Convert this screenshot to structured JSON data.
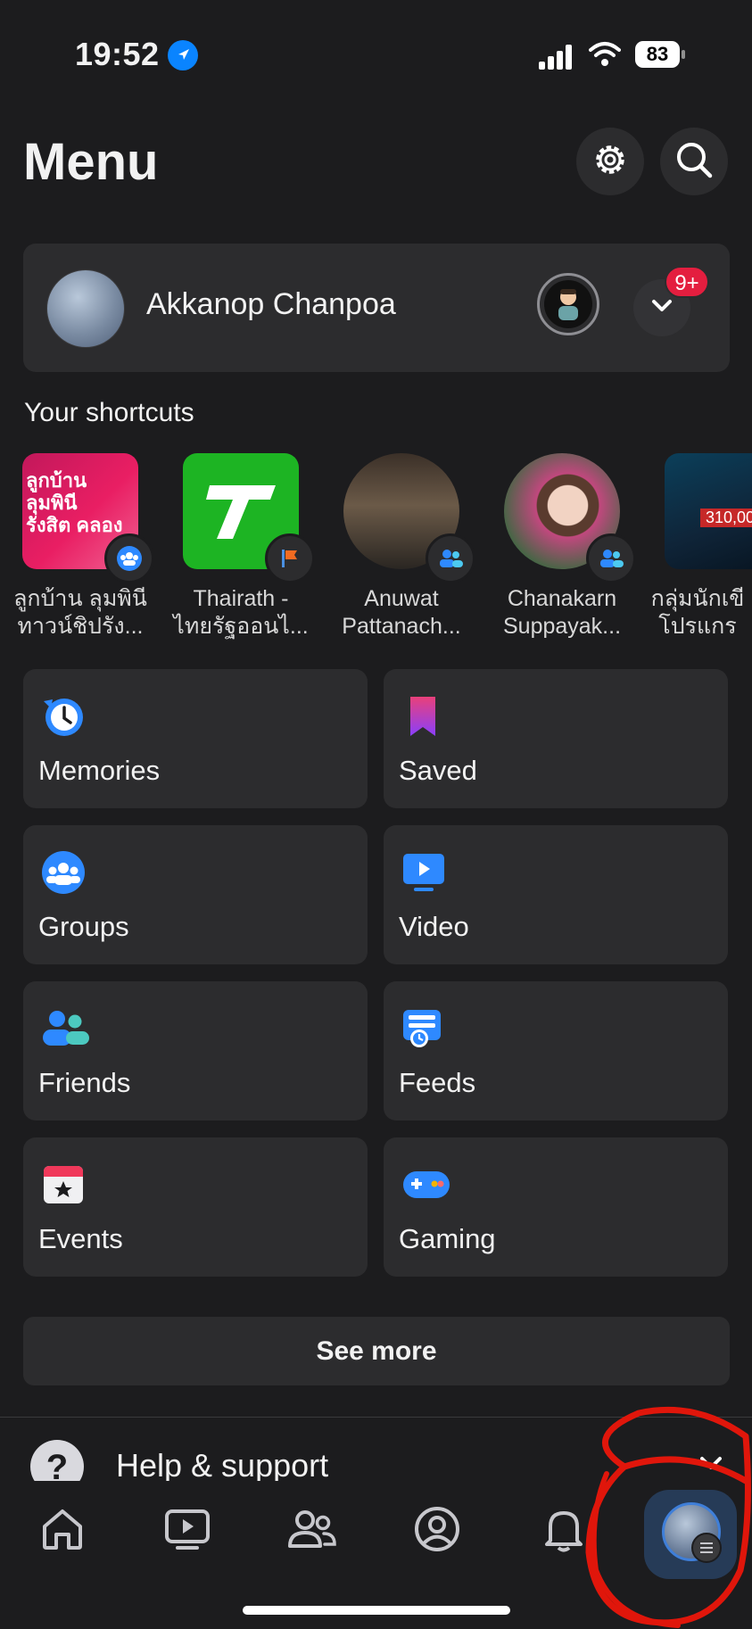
{
  "status_bar": {
    "time": "19:52",
    "battery": "83"
  },
  "header": {
    "title": "Menu"
  },
  "profile": {
    "name": "Akkanop Chanpoa",
    "notification_badge": "9+"
  },
  "shortcuts": {
    "title": "Your shortcuts",
    "items": [
      {
        "label": "ลูกบ้าน ลุมพินี\nทาวน์ชิปรัง...",
        "thumb_text": "ลูกบ้าน\nลุมพินี\nรังสิต คลอง"
      },
      {
        "label": "Thairath -\nไทยรัฐออนไ..."
      },
      {
        "label": "Anuwat\nPattanach..."
      },
      {
        "label": "Chanakarn\nSuppayak..."
      },
      {
        "label": "กลุ่มนักเขี\nโปรแกร",
        "thumb_text": "310,00"
      }
    ]
  },
  "menu": {
    "items": [
      {
        "label": "Memories",
        "icon": "memories-icon"
      },
      {
        "label": "Saved",
        "icon": "saved-icon"
      },
      {
        "label": "Groups",
        "icon": "groups-icon"
      },
      {
        "label": "Video",
        "icon": "video-icon"
      },
      {
        "label": "Friends",
        "icon": "friends-icon"
      },
      {
        "label": "Feeds",
        "icon": "feeds-icon"
      },
      {
        "label": "Events",
        "icon": "events-icon"
      },
      {
        "label": "Gaming",
        "icon": "gaming-icon"
      }
    ],
    "see_more": "See more"
  },
  "help": {
    "label": "Help & support"
  },
  "colors": {
    "background": "#1c1c1e",
    "card": "#2c2c2e",
    "accent": "#0a84ff",
    "badge": "#e41e3f",
    "annotation": "#e0160b"
  }
}
